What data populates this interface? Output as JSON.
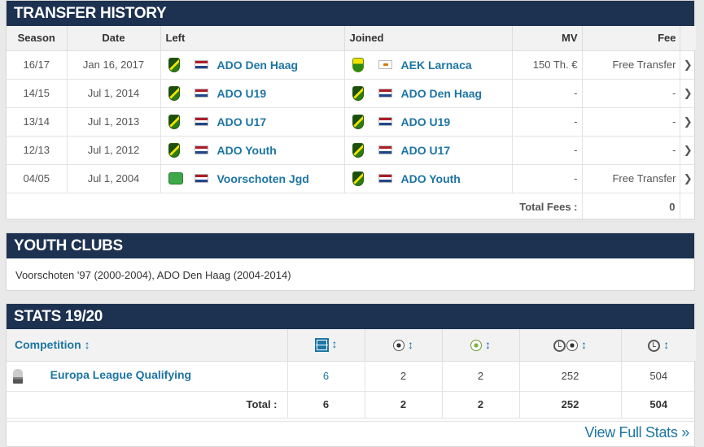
{
  "transfer_history": {
    "title": "Transfer history",
    "headers": {
      "season": "Season",
      "date": "Date",
      "left": "Left",
      "joined": "Joined",
      "mv": "MV",
      "fee": "Fee"
    },
    "rows": [
      {
        "season": "16/17",
        "date": "Jan 16, 2017",
        "left_club": "ADO Den Haag",
        "left_flag": "netherlands-flag",
        "left_crest": "ado-crest",
        "joined_club": "AEK Larnaca",
        "joined_flag": "cyprus-flag",
        "joined_crest": "aek-crest",
        "mv": "150 Th. €",
        "fee": "Free Transfer"
      },
      {
        "season": "14/15",
        "date": "Jul 1, 2014",
        "left_club": "ADO U19",
        "left_flag": "netherlands-flag",
        "left_crest": "ado-crest",
        "joined_club": "ADO Den Haag",
        "joined_flag": "netherlands-flag",
        "joined_crest": "ado-crest",
        "mv": "-",
        "fee": "-"
      },
      {
        "season": "13/14",
        "date": "Jul 1, 2013",
        "left_club": "ADO U17",
        "left_flag": "netherlands-flag",
        "left_crest": "ado-crest",
        "joined_club": "ADO U19",
        "joined_flag": "netherlands-flag",
        "joined_crest": "ado-crest",
        "mv": "-",
        "fee": "-"
      },
      {
        "season": "12/13",
        "date": "Jul 1, 2012",
        "left_club": "ADO Youth",
        "left_flag": "netherlands-flag",
        "left_crest": "ado-crest",
        "joined_club": "ADO U17",
        "joined_flag": "netherlands-flag",
        "joined_crest": "ado-crest",
        "mv": "-",
        "fee": "-"
      },
      {
        "season": "04/05",
        "date": "Jul 1, 2004",
        "left_club": "Voorschoten Jgd",
        "left_flag": "netherlands-flag",
        "left_crest": "voorschoten-crest",
        "joined_club": "ADO Youth",
        "joined_flag": "netherlands-flag",
        "joined_crest": "ado-crest",
        "mv": "-",
        "fee": "Free Transfer"
      }
    ],
    "total_label": "Total Fees :",
    "total_value": "0"
  },
  "youth_clubs": {
    "title": "Youth clubs",
    "text": "Voorschoten '97 (2000-2004), ADO Den Haag (2004-2014)"
  },
  "stats": {
    "title": "Stats 19/20",
    "headers": {
      "competition": "Competition",
      "sort_glyph": "↕",
      "icons": [
        "appearances-icon",
        "goals-icon",
        "assists-icon",
        "minutes-per-goal-icon",
        "minutes-played-icon"
      ]
    },
    "rows": [
      {
        "competition": "Europa League Qualifying",
        "apps": "6",
        "goals": "2",
        "assists": "2",
        "min_per_goal": "252",
        "minutes": "504"
      }
    ],
    "total": {
      "label": "Total :",
      "apps": "6",
      "goals": "2",
      "assists": "2",
      "min_per_goal": "252",
      "minutes": "504"
    },
    "view_full": "View Full Stats »"
  },
  "colors": {
    "header_bg": "#1d3150",
    "link": "#1d75a3",
    "page_bg": "#e9e9e9"
  }
}
